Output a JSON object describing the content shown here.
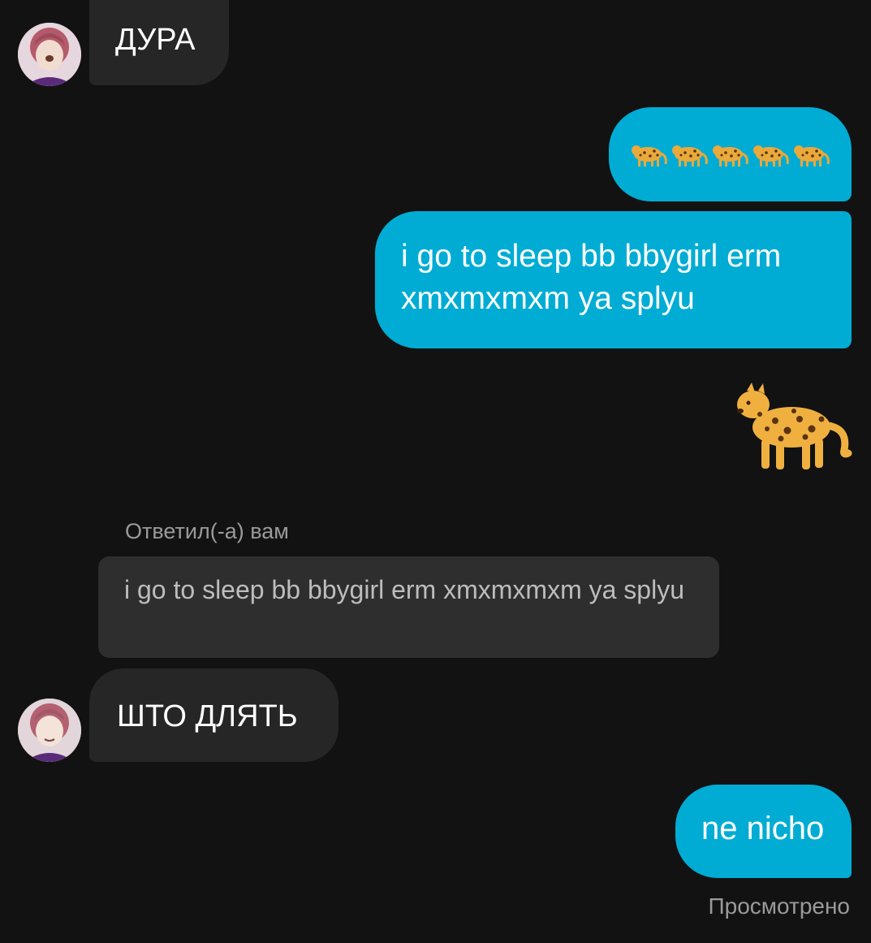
{
  "messages": [
    {
      "id": 1,
      "side": "incoming",
      "text": "ДУРА"
    },
    {
      "id": 2,
      "side": "outgoing",
      "emoji": "leopard-emoji",
      "count": 5
    },
    {
      "id": 3,
      "side": "outgoing",
      "text": "i go to sleep bb bbygirl erm xmxmxmxm ya splyu"
    },
    {
      "id": 4,
      "side": "outgoing",
      "emoji": "leopard-emoji-large"
    },
    {
      "id": 5,
      "side": "incoming",
      "reply_label": "Ответил(-а) вам",
      "reply_quote": "i go to sleep bb bbygirl erm xmxmxmxm ya splyu",
      "text": "ШТО ДЛЯТЬ"
    },
    {
      "id": 6,
      "side": "outgoing",
      "text": "ne nicho"
    }
  ],
  "status": {
    "seen": "Просмотрено"
  },
  "colors": {
    "background": "#121212",
    "incoming_bubble": "#262626",
    "outgoing_bubble": "#00acd4",
    "reply_quote_bg": "#2e2e2e",
    "muted_text": "#9a9a9a"
  }
}
